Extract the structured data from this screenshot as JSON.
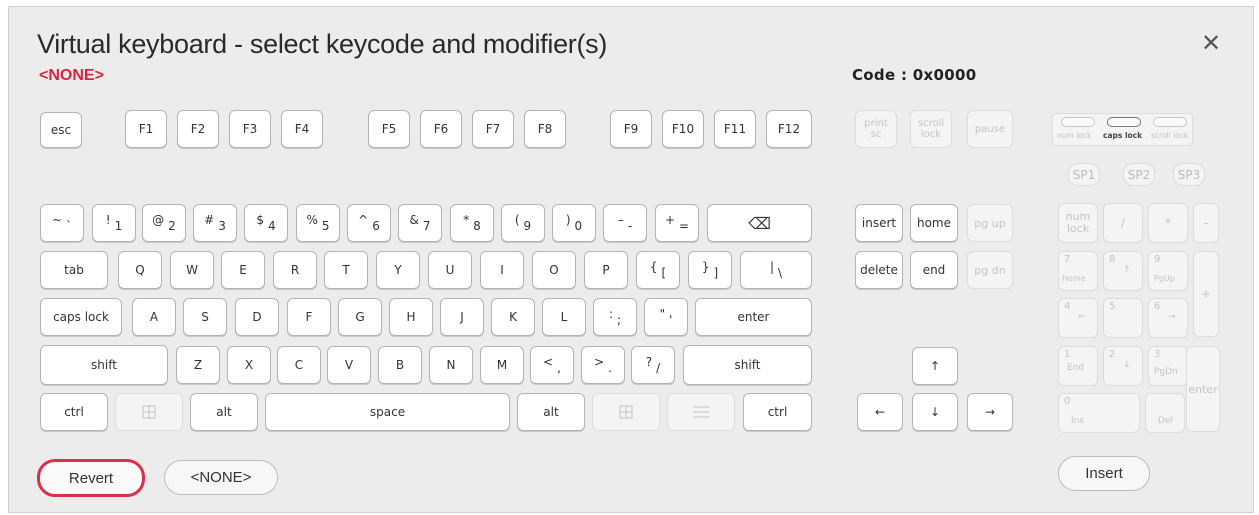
{
  "dialog": {
    "title": "Virtual keyboard - select keycode and modifier(s)",
    "close_glyph": "✕",
    "selected": "<NONE>",
    "code": "Code : 0x0000"
  },
  "keys": {
    "esc": "esc",
    "f1": "F1",
    "f2": "F2",
    "f3": "F3",
    "f4": "F4",
    "f5": "F5",
    "f6": "F6",
    "f7": "F7",
    "f8": "F8",
    "f9": "F9",
    "f10": "F10",
    "f11": "F11",
    "f12": "F12",
    "print_top": "print",
    "print_bot": "sc",
    "scroll_top": "scroll",
    "scroll_bot": "lock",
    "pause": "pause",
    "tilde_shift": "~",
    "tilde_base": "`",
    "n1_shift": "!",
    "n1_base": "1",
    "n2_shift": "@",
    "n2_base": "2",
    "n3_shift": "#",
    "n3_base": "3",
    "n4_shift": "$",
    "n4_base": "4",
    "n5_shift": "%",
    "n5_base": "5",
    "n6_shift": "^",
    "n6_base": "6",
    "n7_shift": "&",
    "n7_base": "7",
    "n8_shift": "*",
    "n8_base": "8",
    "n9_shift": "(",
    "n9_base": "9",
    "n0_shift": ")",
    "n0_base": "0",
    "minus_shift": "–",
    "minus_base": "-",
    "equal_shift": "+",
    "equal_base": "=",
    "backspace": "⌫",
    "tab": "tab",
    "q": "Q",
    "w": "W",
    "e": "E",
    "r": "R",
    "t": "T",
    "y": "Y",
    "u": "U",
    "i": "I",
    "o": "O",
    "p": "P",
    "lbr_shift": "{",
    "lbr_base": "[",
    "rbr_shift": "}",
    "rbr_base": "]",
    "bsl_shift": "|",
    "bsl_base": "\\",
    "caps": "caps lock",
    "a": "A",
    "s": "S",
    "d": "D",
    "f": "F",
    "g": "G",
    "h": "H",
    "j": "J",
    "k": "K",
    "l": "L",
    "semi_shift": ":",
    "semi_base": ";",
    "quote_shift": "\"",
    "quote_base": "'",
    "enter": "enter",
    "shift_l": "shift",
    "z": "Z",
    "x": "X",
    "c": "C",
    "v": "V",
    "b": "B",
    "n": "N",
    "m": "M",
    "comma_shift": "<",
    "comma_base": ",",
    "period_shift": ">",
    "period_base": ".",
    "slash_shift": "?",
    "slash_base": "/",
    "shift_r": "shift",
    "ctrl_l": "ctrl",
    "alt_l": "alt",
    "space": "space",
    "alt_r": "alt",
    "ctrl_r": "ctrl",
    "insert": "insert",
    "home": "home",
    "pgup": "pg up",
    "delete": "delete",
    "end": "end",
    "pgdn": "pg dn",
    "up": "↑",
    "left": "←",
    "down": "↓",
    "right": "→"
  },
  "locks": {
    "num": "num lock",
    "caps": "caps lock",
    "scroll": "scroll lock"
  },
  "special": {
    "sp1": "SP1",
    "sp2": "SP2",
    "sp3": "SP3"
  },
  "numpad": {
    "numlock_top": "num",
    "numlock_bot": "lock",
    "div": "/",
    "mul": "*",
    "sub": "-",
    "add": "+",
    "enter": "enter",
    "n7": "7",
    "n7_sub": "Home",
    "n8": "8",
    "n8_sub": "↑",
    "n9": "9",
    "n9_sub": "PgUp",
    "n4": "4",
    "n4_sub": "←",
    "n5": "5",
    "n6": "6",
    "n6_sub": "→",
    "n1": "1",
    "n1_sub": "End",
    "n2": "2",
    "n2_sub": "↓",
    "n3": "3",
    "n3_sub": "PgDn",
    "n0": "0",
    "n0_sub": "Ins",
    "dot_sub": "Del"
  },
  "buttons": {
    "revert": "Revert",
    "none": "<NONE>",
    "insert": "Insert"
  },
  "colors": {
    "accent_red": "#d8243c"
  },
  "icons": {
    "close": "close-icon",
    "backspace": "backspace-icon",
    "windows": "windows-icon",
    "menu": "menu-icon"
  }
}
